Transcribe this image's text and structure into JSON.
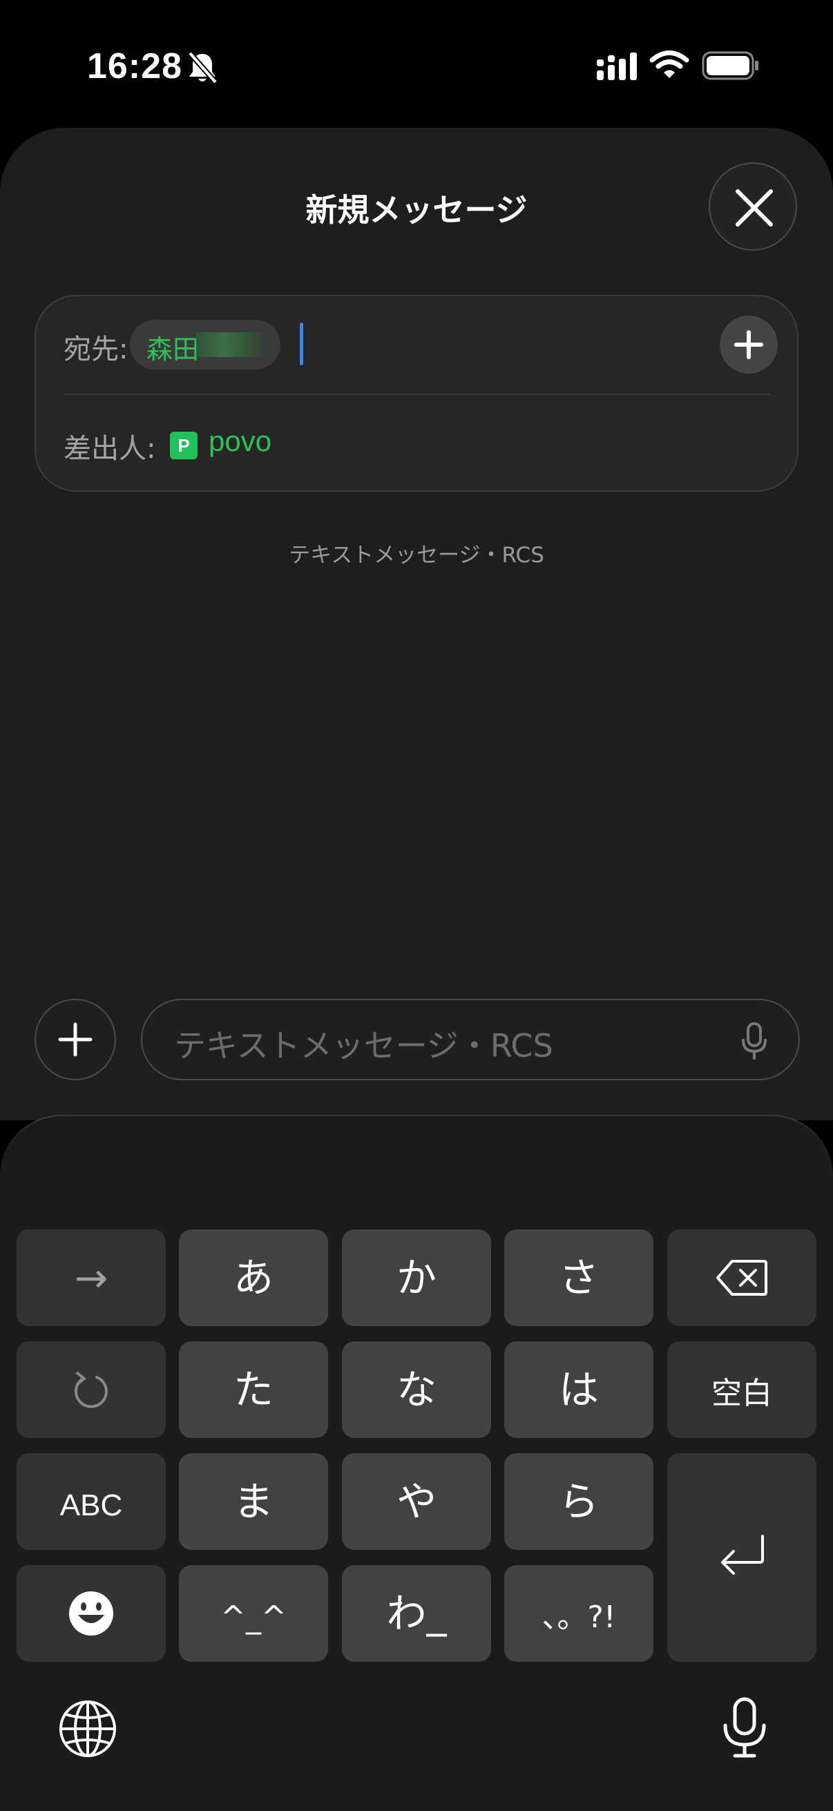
{
  "status_bar": {
    "time": "16:28",
    "icons": [
      "bell-slash-icon",
      "cellular-signal-icon",
      "wifi-icon",
      "battery-icon"
    ]
  },
  "sheet": {
    "title": "新規メッセージ",
    "close_icon": "close-icon"
  },
  "recipient": {
    "to_label": "宛先:",
    "recipient_name": "森田",
    "add_icon": "plus-icon",
    "from_label": "差出人:",
    "carrier_badge": "P",
    "carrier_name": "povo"
  },
  "service_caption": "テキストメッセージ・RCS",
  "compose": {
    "attach_icon": "plus-icon",
    "placeholder": "テキストメッセージ・RCS",
    "dictation_icon": "microphone-icon"
  },
  "keyboard": {
    "row1": [
      "→",
      "あ",
      "か",
      "さ"
    ],
    "backspace_icon": "backspace-icon",
    "row2_undo_icon": "undo-icon",
    "row2": [
      "た",
      "な",
      "は",
      "空白"
    ],
    "row3": [
      "ABC",
      "ま",
      "や",
      "ら"
    ],
    "return_icon": "return-icon",
    "row4_emoji_icon": "emoji-icon",
    "row4": [
      "^_^",
      "わ_",
      "、。?!"
    ],
    "globe_icon": "globe-icon",
    "mic_icon": "microphone-icon"
  },
  "colors": {
    "accent_green": "#2fc15a",
    "cursor_blue": "#3b82f6",
    "key_background": "#424242"
  }
}
